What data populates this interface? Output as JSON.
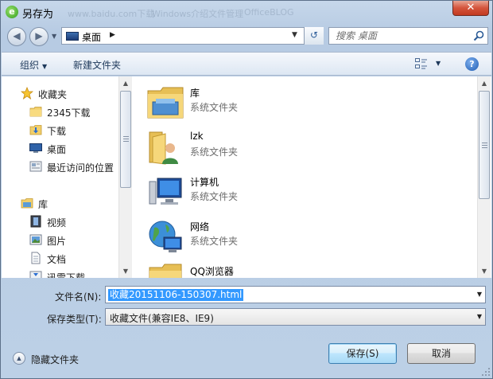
{
  "window": {
    "title": "另存为",
    "close_label": "✕"
  },
  "ghost_tabs": [
    "www.baidu.com下载",
    "Windows介绍文件管理",
    "OfficeBLOG"
  ],
  "address": {
    "location": "桌面",
    "search_placeholder": "搜索 桌面"
  },
  "toolbar": {
    "organize_label": "组织",
    "new_folder_label": "新建文件夹",
    "help_label": "?"
  },
  "nav_pane": {
    "items": [
      {
        "label": "收藏夹",
        "icon": "star-icon"
      },
      {
        "label": "2345下载",
        "icon": "folder-icon"
      },
      {
        "label": "下载",
        "icon": "download-folder-icon"
      },
      {
        "label": "桌面",
        "icon": "desktop-icon"
      },
      {
        "label": "最近访问的位置",
        "icon": "recent-places-icon"
      },
      {
        "label": "库",
        "icon": "library-icon"
      },
      {
        "label": "视频",
        "icon": "video-icon"
      },
      {
        "label": "图片",
        "icon": "picture-icon"
      },
      {
        "label": "文档",
        "icon": "document-icon"
      },
      {
        "label": "迅雷下载",
        "icon": "thunder-download-icon"
      }
    ]
  },
  "files": [
    {
      "name": "库",
      "type": "系统文件夹",
      "icon": "library-folder-icon"
    },
    {
      "name": "lzk",
      "type": "系统文件夹",
      "icon": "user-folder-icon"
    },
    {
      "name": "计算机",
      "type": "系统文件夹",
      "icon": "computer-icon"
    },
    {
      "name": "网络",
      "type": "系统文件夹",
      "icon": "network-icon"
    },
    {
      "name": "QQ浏览器",
      "type": "",
      "icon": "folder-icon"
    }
  ],
  "form": {
    "filename_label": "文件名(N):",
    "filename_value": "收藏20151106-150307.html",
    "filetype_label": "保存类型(T):",
    "filetype_value": "收藏文件(兼容IE8、IE9)"
  },
  "footer": {
    "hide_folders_label": "隐藏文件夹",
    "save_label": "保存(S)",
    "cancel_label": "取消"
  },
  "colors": {
    "selection": "#3399ff",
    "frame": "#b7cbe3",
    "close": "#c23a20"
  }
}
